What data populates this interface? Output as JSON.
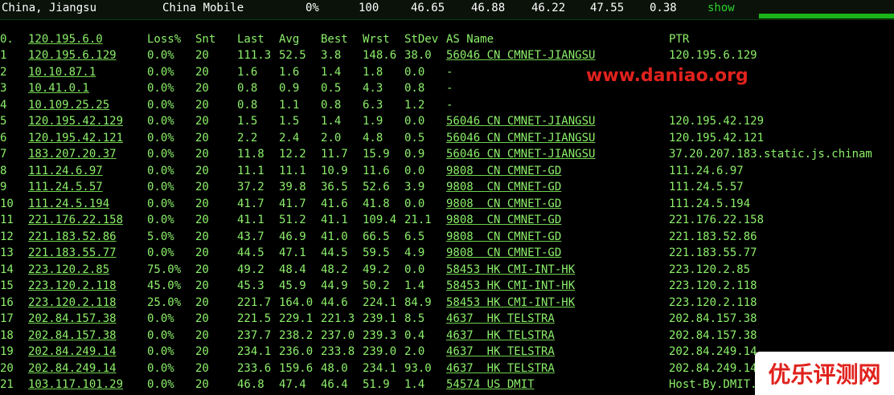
{
  "topbar": {
    "location": "China, Jiangsu",
    "isp": "China Mobile",
    "loss": "0%",
    "snt": "100",
    "last": "46.65",
    "avg": "46.88",
    "best": "46.22",
    "wrst": "47.55",
    "stdev": "0.38",
    "show_label": "show"
  },
  "headers": {
    "idx": "0.",
    "host": "120.195.6.0",
    "loss": "Loss%",
    "snt": "Snt",
    "last": "Last",
    "avg": "Avg",
    "best": "Best",
    "wrst": "Wrst",
    "stdev": "StDev",
    "asname": "AS Name",
    "ptr": "PTR"
  },
  "hops": [
    {
      "idx": "1",
      "host": "120.195.6.129",
      "loss": "0.0%",
      "snt": "20",
      "last": "111.3",
      "avg": "52.5",
      "best": "3.8",
      "wrst": "148.6",
      "stdev": "38.0",
      "asname": "56046 CN CMNET-JIANGSU",
      "ptr": "120.195.6.129"
    },
    {
      "idx": "2",
      "host": "10.10.87.1",
      "loss": "0.0%",
      "snt": "20",
      "last": "1.6",
      "avg": "1.6",
      "best": "1.4",
      "wrst": "1.8",
      "stdev": "0.0",
      "asname": "-",
      "ptr": ""
    },
    {
      "idx": "3",
      "host": "10.41.0.1",
      "loss": "0.0%",
      "snt": "20",
      "last": "0.8",
      "avg": "0.9",
      "best": "0.5",
      "wrst": "4.3",
      "stdev": "0.8",
      "asname": "-",
      "ptr": ""
    },
    {
      "idx": "4",
      "host": "10.109.25.25",
      "loss": "0.0%",
      "snt": "20",
      "last": "0.8",
      "avg": "1.1",
      "best": "0.8",
      "wrst": "6.3",
      "stdev": "1.2",
      "asname": "-",
      "ptr": ""
    },
    {
      "idx": "5",
      "host": "120.195.42.129",
      "loss": "0.0%",
      "snt": "20",
      "last": "1.5",
      "avg": "1.5",
      "best": "1.4",
      "wrst": "1.9",
      "stdev": "0.0",
      "asname": "56046 CN CMNET-JIANGSU",
      "ptr": "120.195.42.129"
    },
    {
      "idx": "6",
      "host": "120.195.42.121",
      "loss": "0.0%",
      "snt": "20",
      "last": "2.2",
      "avg": "2.4",
      "best": "2.0",
      "wrst": "4.8",
      "stdev": "0.5",
      "asname": "56046 CN CMNET-JIANGSU",
      "ptr": "120.195.42.121"
    },
    {
      "idx": "7",
      "host": "183.207.20.37",
      "loss": "0.0%",
      "snt": "20",
      "last": "11.8",
      "avg": "12.2",
      "best": "11.7",
      "wrst": "15.9",
      "stdev": "0.9",
      "asname": "56046 CN CMNET-JIANGSU",
      "ptr": "37.20.207.183.static.js.chinam"
    },
    {
      "idx": "8",
      "host": "111.24.6.97",
      "loss": "0.0%",
      "snt": "20",
      "last": "11.1",
      "avg": "11.1",
      "best": "10.9",
      "wrst": "11.6",
      "stdev": "0.0",
      "asname": "9808  CN CMNET-GD",
      "ptr": "111.24.6.97"
    },
    {
      "idx": "9",
      "host": "111.24.5.57",
      "loss": "0.0%",
      "snt": "20",
      "last": "37.2",
      "avg": "39.8",
      "best": "36.5",
      "wrst": "52.6",
      "stdev": "3.9",
      "asname": "9808  CN CMNET-GD",
      "ptr": "111.24.5.57"
    },
    {
      "idx": "10",
      "host": "111.24.5.194",
      "loss": "0.0%",
      "snt": "20",
      "last": "41.7",
      "avg": "41.7",
      "best": "41.6",
      "wrst": "41.8",
      "stdev": "0.0",
      "asname": "9808  CN CMNET-GD",
      "ptr": "111.24.5.194"
    },
    {
      "idx": "11",
      "host": "221.176.22.158",
      "loss": "0.0%",
      "snt": "20",
      "last": "41.1",
      "avg": "51.2",
      "best": "41.1",
      "wrst": "109.4",
      "stdev": "21.1",
      "asname": "9808  CN CMNET-GD",
      "ptr": "221.176.22.158"
    },
    {
      "idx": "12",
      "host": "221.183.52.86",
      "loss": "5.0%",
      "snt": "20",
      "last": "43.7",
      "avg": "46.9",
      "best": "41.0",
      "wrst": "66.5",
      "stdev": "6.5",
      "asname": "9808  CN CMNET-GD",
      "ptr": "221.183.52.86"
    },
    {
      "idx": "13",
      "host": "221.183.55.77",
      "loss": "0.0%",
      "snt": "20",
      "last": "44.5",
      "avg": "47.1",
      "best": "44.5",
      "wrst": "59.5",
      "stdev": "4.9",
      "asname": "9808  CN CMNET-GD",
      "ptr": "221.183.55.77"
    },
    {
      "idx": "14",
      "host": "223.120.2.85",
      "loss": "75.0%",
      "snt": "20",
      "last": "49.2",
      "avg": "48.4",
      "best": "48.2",
      "wrst": "49.2",
      "stdev": "0.0",
      "asname": "58453 HK CMI-INT-HK",
      "ptr": "223.120.2.85"
    },
    {
      "idx": "15",
      "host": "223.120.2.118",
      "loss": "45.0%",
      "snt": "20",
      "last": "45.3",
      "avg": "45.9",
      "best": "44.9",
      "wrst": "50.2",
      "stdev": "1.4",
      "asname": "58453 HK CMI-INT-HK",
      "ptr": "223.120.2.118"
    },
    {
      "idx": "16",
      "host": "223.120.2.118",
      "loss": "25.0%",
      "snt": "20",
      "last": "221.7",
      "avg": "164.0",
      "best": "44.6",
      "wrst": "224.1",
      "stdev": "84.9",
      "asname": "58453 HK CMI-INT-HK",
      "ptr": "223.120.2.118"
    },
    {
      "idx": "17",
      "host": "202.84.157.38",
      "loss": "0.0%",
      "snt": "20",
      "last": "221.5",
      "avg": "229.1",
      "best": "221.3",
      "wrst": "239.1",
      "stdev": "8.5",
      "asname": "4637  HK TELSTRA",
      "ptr": "202.84.157.38"
    },
    {
      "idx": "18",
      "host": "202.84.157.38",
      "loss": "0.0%",
      "snt": "20",
      "last": "237.7",
      "avg": "238.2",
      "best": "237.0",
      "wrst": "239.3",
      "stdev": "0.4",
      "asname": "4637  HK TELSTRA",
      "ptr": "202.84.157.38"
    },
    {
      "idx": "19",
      "host": "202.84.249.14",
      "loss": "0.0%",
      "snt": "20",
      "last": "234.1",
      "avg": "236.0",
      "best": "233.8",
      "wrst": "239.0",
      "stdev": "2.0",
      "asname": "4637  HK TELSTRA",
      "ptr": "202.84.249.14"
    },
    {
      "idx": "20",
      "host": "202.84.249.14",
      "loss": "0.0%",
      "snt": "20",
      "last": "233.6",
      "avg": "159.6",
      "best": "48.0",
      "wrst": "234.1",
      "stdev": "93.0",
      "asname": "4637  HK TELSTRA",
      "ptr": "202.84.249.14"
    },
    {
      "idx": "21",
      "host": "103.117.101.29",
      "loss": "0.0%",
      "snt": "20",
      "last": "46.8",
      "avg": "47.4",
      "best": "46.4",
      "wrst": "51.9",
      "stdev": "1.4",
      "asname": "54574 US DMIT",
      "ptr": "Host-By.DMIT."
    }
  ],
  "watermark": "www.daniao.org",
  "logo_text": "优乐评测网",
  "colors": {
    "text": "#8cf06a",
    "accent": "#19b519",
    "watermark": "#e0221d"
  }
}
